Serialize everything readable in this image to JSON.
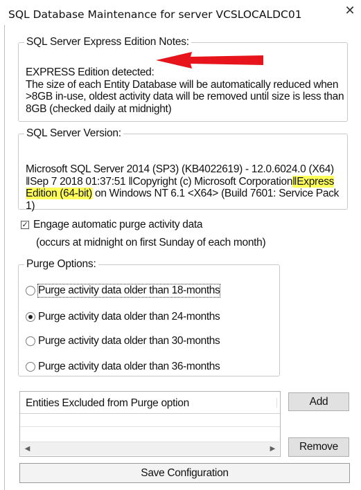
{
  "window": {
    "title": "SQL Database Maintenance for server VCSLOCALDC01",
    "close_glyph": "✕"
  },
  "notes": {
    "legend": "SQL Server Express Edition Notes:",
    "line1": "EXPRESS Edition detected:",
    "body": "The size of each Entity Database will be automatically reduced when >8GB in-use, oldest activity data will be removed until size is less than 8GB (checked daily at midnight)"
  },
  "version": {
    "legend": "SQL Server Version:",
    "before_highlight": "Microsoft SQL Server 2014 (SP3) (KB4022619) - 12.0.6024.0 (X64) ‖Sep  7 2018 01:37:51 ‖Copyright (c) Microsoft Corporation",
    "highlight": "‖Express Edition (64-bit)",
    "after_highlight": " on Windows NT 6.1 <X64> (Build 7601: Service Pack 1)"
  },
  "purge_check": {
    "label": "Engage automatic purge activity data",
    "sub": "(occurs at midnight on first Sunday of each month)",
    "checked": true,
    "check_glyph": "✓"
  },
  "purge_options": {
    "legend": "Purge Options:",
    "options": [
      {
        "label": "Purge activity data older than 18-months",
        "selected": false
      },
      {
        "label": "Purge activity data older than 24-months",
        "selected": true
      },
      {
        "label": "Purge activity data older than 30-months",
        "selected": false
      },
      {
        "label": "Purge activity data older than 36-months",
        "selected": false
      }
    ]
  },
  "excluded": {
    "header": "Entities Excluded from Purge option",
    "scroll_left": "◀",
    "scroll_right": "▶"
  },
  "buttons": {
    "add": "Add",
    "remove": "Remove",
    "save": "Save Configuration"
  },
  "colors": {
    "highlight": "#ffff5a",
    "arrow": "#e8141c"
  }
}
